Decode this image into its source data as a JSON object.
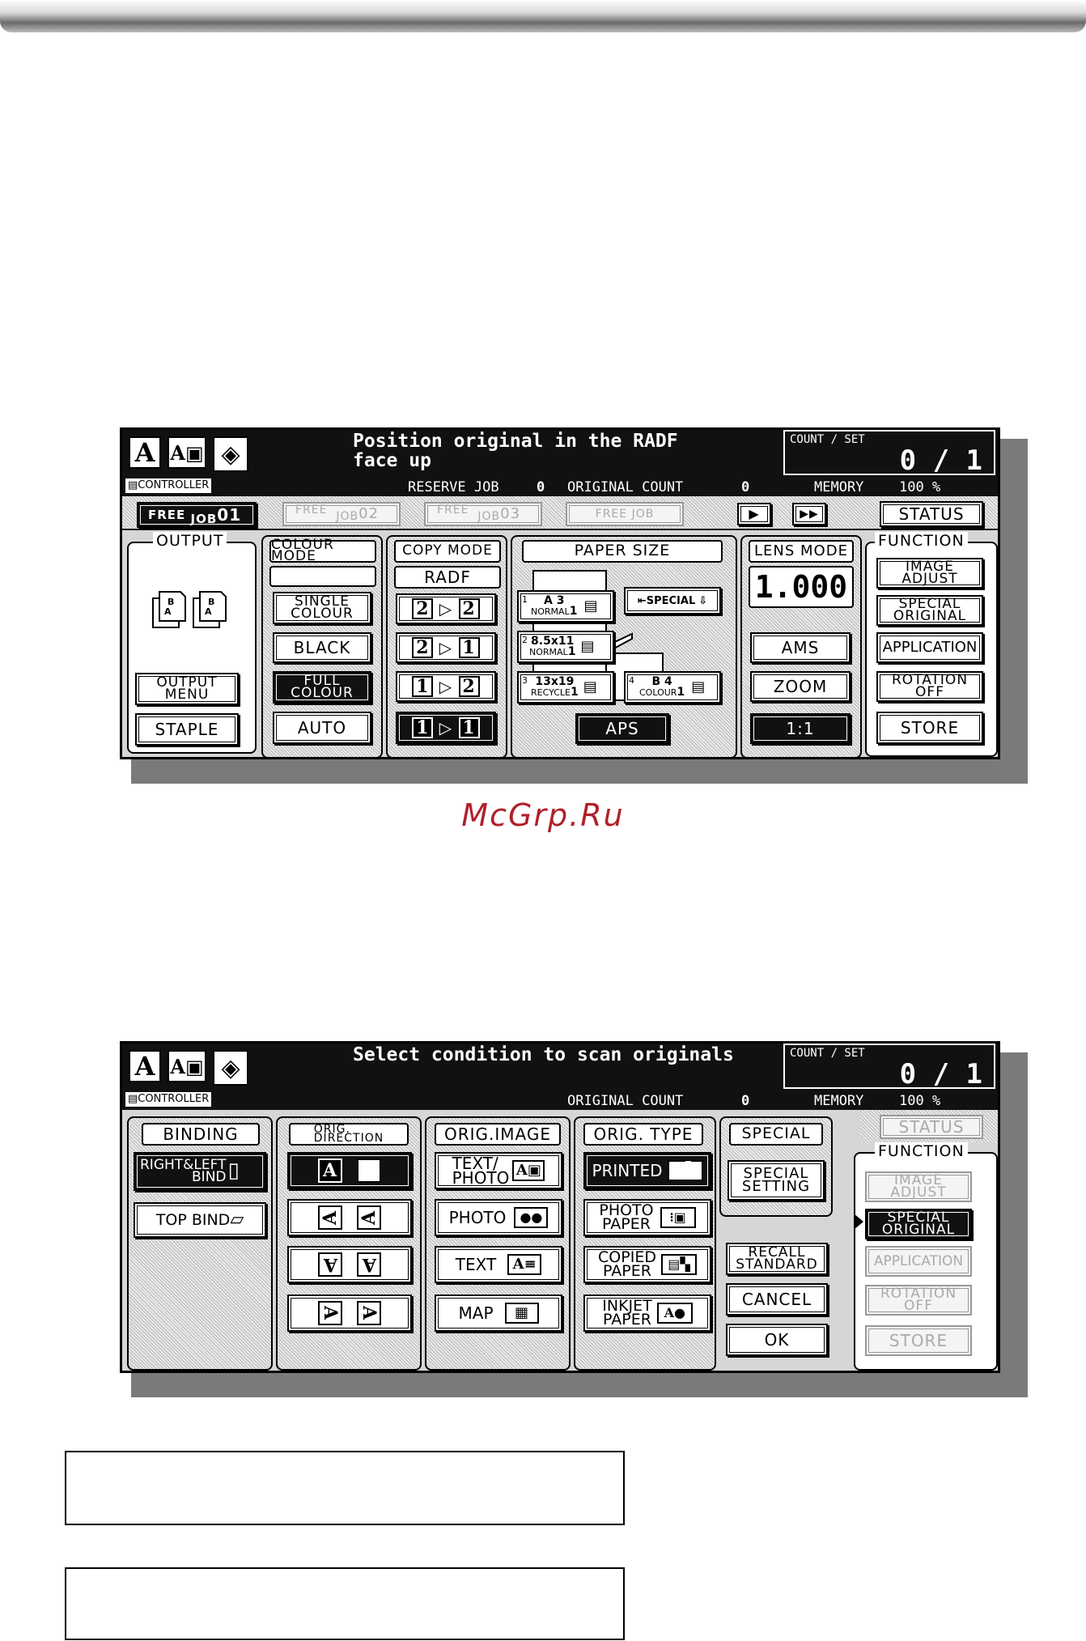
{
  "watermark": "McGrp.Ru",
  "screen1": {
    "message": "Position original in the RADF\nface up",
    "count_label": "COUNT / SET",
    "count_value": "0 / 1",
    "controller": "CONTROLLER",
    "reserve_job_label": "RESERVE JOB",
    "reserve_job_value": "0",
    "original_count_label": "ORIGINAL COUNT",
    "original_count_value": "0",
    "memory_label": "MEMORY",
    "memory_value": "100 %",
    "jobs": [
      {
        "free": "FREE",
        "job": "JOB",
        "num": "01"
      },
      {
        "free": "FREE",
        "job": "JOB",
        "num": "02"
      },
      {
        "free": "FREE",
        "job": "JOB",
        "num": "03"
      },
      {
        "free": "FREE JOB",
        "job": "",
        "num": ""
      }
    ],
    "status": "STATUS",
    "output": {
      "title": "OUTPUT",
      "menu": "OUTPUT\nMENU",
      "staple": "STAPLE"
    },
    "colour_mode": {
      "title": "COLOUR MODE",
      "single": "SINGLE\nCOLOUR",
      "black": "BLACK",
      "full": "FULL\nCOLOUR",
      "auto": "AUTO"
    },
    "copy_mode": {
      "title": "COPY MODE",
      "radf": "RADF",
      "modes": [
        [
          "2",
          "2"
        ],
        [
          "2",
          "1"
        ],
        [
          "1",
          "2"
        ],
        [
          "1",
          "1"
        ]
      ]
    },
    "paper_size": {
      "title": "PAPER SIZE",
      "trays": [
        {
          "n": "1",
          "size": "A 3",
          "type": "NORMAL",
          "v": "1"
        },
        {
          "n": "2",
          "size": "8.5x11",
          "type": "NORMAL",
          "v": "1"
        },
        {
          "n": "3",
          "size": "13x19",
          "type": "RECYCLE",
          "v": "1"
        },
        {
          "n": "4",
          "size": "B 4",
          "type": "COLOUR",
          "v": "1"
        }
      ],
      "special": "SPECIAL",
      "aps": "APS"
    },
    "lens_mode": {
      "title": "LENS MODE",
      "value": "1.000",
      "ams": "AMS",
      "zoom": "ZOOM",
      "one": "1:1"
    },
    "function": {
      "title": "FUNCTION",
      "items": [
        "IMAGE\nADJUST",
        "SPECIAL\nORIGINAL",
        "APPLICATION",
        "ROTATION\nOFF",
        "STORE"
      ]
    }
  },
  "screen2": {
    "message": "Select condition to scan originals",
    "count_label": "COUNT / SET",
    "count_value": "0 / 1",
    "controller": "CONTROLLER",
    "original_count_label": "ORIGINAL COUNT",
    "original_count_value": "0",
    "memory_label": "MEMORY",
    "memory_value": "100 %",
    "status": "STATUS",
    "binding": {
      "title": "BINDING",
      "rl": "RIGHT&LEFT\nBIND",
      "top": "TOP BIND"
    },
    "orig_direction": {
      "title": "ORIG.\nDIRECTION"
    },
    "orig_image": {
      "title": "ORIG.IMAGE",
      "items": [
        "TEXT/\nPHOTO",
        "PHOTO",
        "TEXT",
        "MAP"
      ]
    },
    "orig_type": {
      "title": "ORIG. TYPE",
      "items": [
        "PRINTED",
        "PHOTO\nPAPER",
        "COPIED\nPAPER",
        "INKJET\nPAPER"
      ]
    },
    "special": {
      "title": "SPECIAL",
      "setting": "SPECIAL\nSETTING"
    },
    "recall": "RECALL\nSTANDARD",
    "cancel": "CANCEL",
    "ok": "OK",
    "function": {
      "title": "FUNCTION",
      "items": [
        "IMAGE\nADJUST",
        "SPECIAL\nORIGINAL",
        "APPLICATION",
        "ROTATION\nOFF",
        "STORE"
      ]
    }
  }
}
